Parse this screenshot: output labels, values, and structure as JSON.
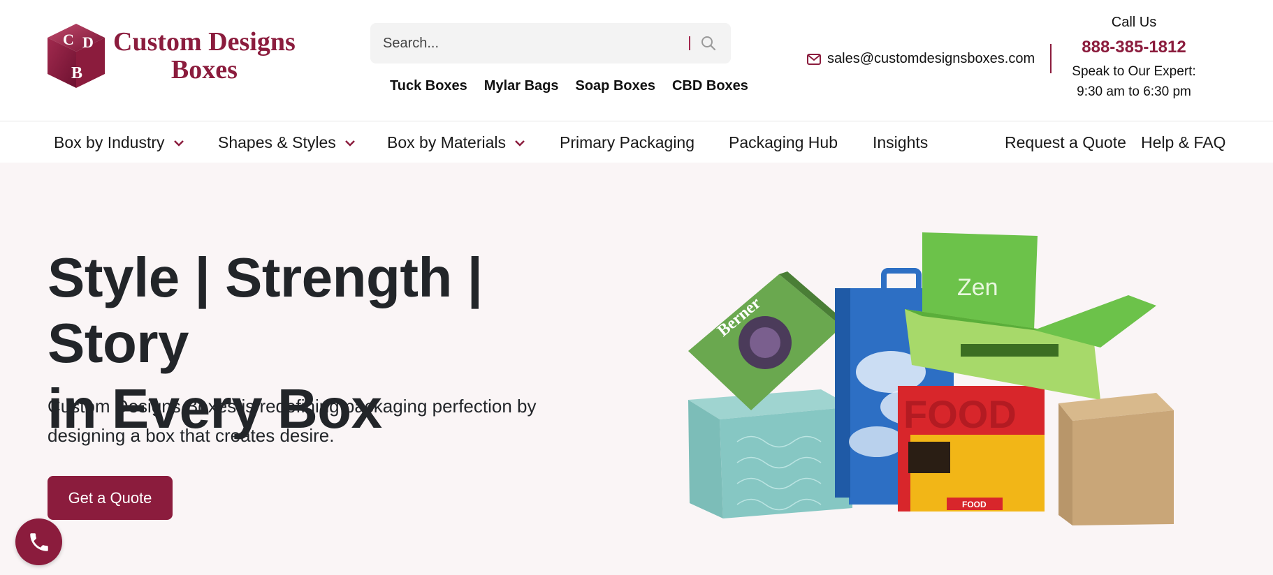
{
  "brand": {
    "name_line1": "Custom Designs",
    "name_line2": "Boxes",
    "logo_letters": [
      "C",
      "D",
      "B"
    ],
    "color": "#8b1c3d"
  },
  "search": {
    "placeholder": "Search...",
    "icon": "search-icon"
  },
  "quick_links": [
    "Tuck Boxes",
    "Mylar Bags",
    "Soap Boxes",
    "CBD Boxes"
  ],
  "contact": {
    "email": "sales@customdesignsboxes.com",
    "call_label": "Call Us",
    "phone": "888-385-1812",
    "expert_line1": "Speak to Our Expert:",
    "expert_line2": "9:30 am to 6:30 pm"
  },
  "nav": {
    "items": [
      {
        "label": "Box by Industry",
        "dropdown": true
      },
      {
        "label": "Shapes & Styles",
        "dropdown": true
      },
      {
        "label": "Box by Materials",
        "dropdown": true
      },
      {
        "label": "Primary Packaging",
        "dropdown": false
      },
      {
        "label": "Packaging Hub",
        "dropdown": false
      },
      {
        "label": "Insights",
        "dropdown": false
      },
      {
        "label": "Request a Quote",
        "dropdown": false
      },
      {
        "label": "Help & FAQ",
        "dropdown": false
      }
    ]
  },
  "hero": {
    "title_line1": "Style | Strength | Story",
    "title_line2": "in Every Box",
    "subtitle_line1": "Custom Designs Boxes is redefining packaging perfection by",
    "subtitle_line2": "designing a box that creates desire.",
    "cta_label": "Get a Quote",
    "box_labels": [
      "Berner",
      "Zen",
      "FOOD",
      "FOOD"
    ]
  },
  "floating": {
    "call_icon": "phone-icon"
  },
  "colors": {
    "accent": "#8b1c3d",
    "hero_bg": "#faf5f6",
    "text_dark": "#222529"
  }
}
